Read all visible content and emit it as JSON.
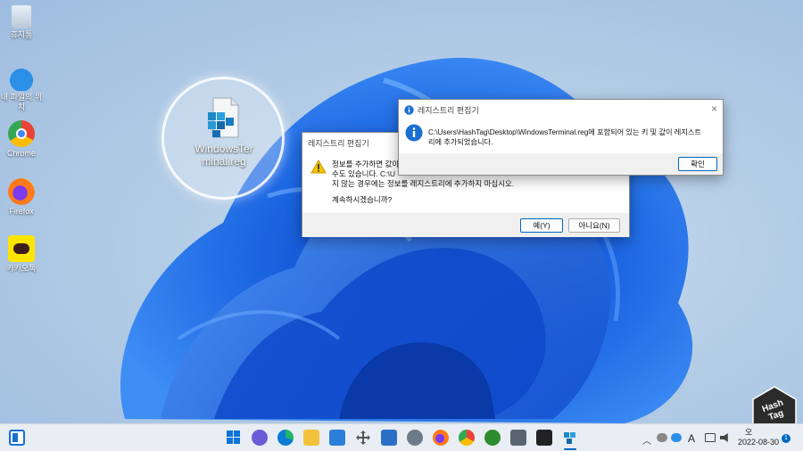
{
  "desktop": {
    "icons": [
      {
        "label": "휴지통"
      },
      {
        "label": "내 파일의 위치"
      },
      {
        "label": "Chrome"
      },
      {
        "label": "Firefox"
      },
      {
        "label": "카카오톡"
      }
    ],
    "highlighted_file": {
      "label_line1": "WindowsTer",
      "label_line2": "minal.reg"
    }
  },
  "confirm_dialog": {
    "title": "레지스트리 편집기",
    "line1": "정보를 추가하면 값이",
    "line2": "수도 있습니다. C:\\U",
    "line3": "지 않는 경우에는 정보를 레지스트리에 추가하지 마십시오.",
    "question": "계속하시겠습니까?",
    "yes_label": "예(Y)",
    "no_label": "아니요(N)"
  },
  "info_dialog": {
    "title": "레지스트리 편집기",
    "close_glyph": "×",
    "message_line1": "C:\\Users\\HashTag\\Desktop\\WindowsTerminal.reg에 포함되어 있는 키 및 값이 레지스트",
    "message_line2": "리에 추가되었습니다.",
    "ok_label": "확인"
  },
  "taskbar": {
    "tray_ime": "A",
    "clock_time": "오",
    "clock_date": "2022-08-30",
    "notification_count": "1"
  },
  "watermark": {
    "line1": "Hash",
    "line2": "Tag"
  },
  "colors": {
    "accent": "#0067c0",
    "wallpaper_blue": "#1a5fd6"
  }
}
